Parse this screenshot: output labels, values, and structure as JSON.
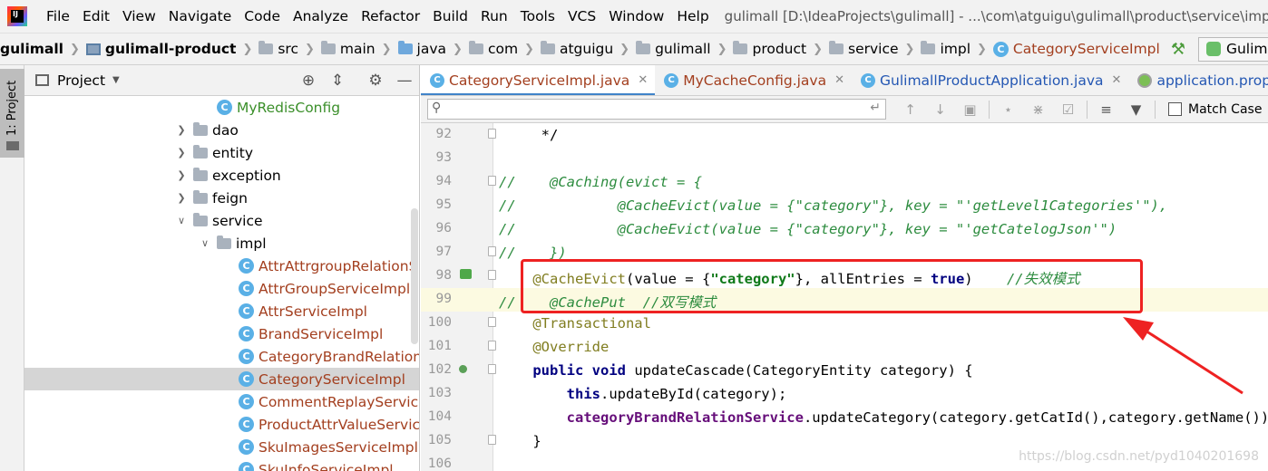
{
  "menubar": {
    "items": [
      "File",
      "Edit",
      "View",
      "Navigate",
      "Code",
      "Analyze",
      "Refactor",
      "Build",
      "Run",
      "Tools",
      "VCS",
      "Window",
      "Help"
    ],
    "title": "gulimall [D:\\IdeaProjects\\gulimall] - ...\\com\\atguigu\\gulimall\\product\\service\\impl\\C"
  },
  "breadcrumb": {
    "items": [
      "gulimall",
      "gulimall-product",
      "src",
      "main",
      "java",
      "com",
      "atguigu",
      "gulimall",
      "product",
      "service",
      "impl",
      "CategoryServiceImpl"
    ],
    "run_config": "GulimallProductApplicat"
  },
  "left_stripe": {
    "project_tab": "1: Project"
  },
  "project_panel": {
    "title": "Project",
    "tree": [
      {
        "label": "MyRedisConfig",
        "kind": "class-green",
        "indent": 2
      },
      {
        "label": "dao",
        "kind": "folder",
        "indent": 1
      },
      {
        "label": "entity",
        "kind": "folder",
        "indent": 1
      },
      {
        "label": "exception",
        "kind": "folder",
        "indent": 1
      },
      {
        "label": "feign",
        "kind": "folder",
        "indent": 1
      },
      {
        "label": "service",
        "kind": "folder-open",
        "indent": 1
      },
      {
        "label": "impl",
        "kind": "folder-open",
        "indent": 2
      },
      {
        "label": "AttrAttrgroupRelationS",
        "kind": "class",
        "indent": 3
      },
      {
        "label": "AttrGroupServiceImpl",
        "kind": "class",
        "indent": 3
      },
      {
        "label": "AttrServiceImpl",
        "kind": "class",
        "indent": 3
      },
      {
        "label": "BrandServiceImpl",
        "kind": "class",
        "indent": 3
      },
      {
        "label": "CategoryBrandRelationS",
        "kind": "class",
        "indent": 3
      },
      {
        "label": "CategoryServiceImpl",
        "kind": "class",
        "indent": 3,
        "selected": true
      },
      {
        "label": "CommentReplayService",
        "kind": "class",
        "indent": 3
      },
      {
        "label": "ProductAttrValueServic",
        "kind": "class",
        "indent": 3
      },
      {
        "label": "SkuImagesServiceImpl",
        "kind": "class",
        "indent": 3
      },
      {
        "label": "SkuInfoServiceImpl",
        "kind": "class",
        "indent": 3
      }
    ]
  },
  "editor_tabs": [
    {
      "label": "CategoryServiceImpl.java",
      "active": true
    },
    {
      "label": "MyCacheConfig.java",
      "active": false
    },
    {
      "label": "GulimallProductApplication.java",
      "active": false
    },
    {
      "label": "application.properties",
      "active": false
    }
  ],
  "search": {
    "placeholder": "",
    "match_case_label": "Match Case"
  },
  "code_lines": [
    {
      "n": "92",
      "html": "     */"
    },
    {
      "n": "93",
      "html": ""
    },
    {
      "n": "94",
      "html": "<span class='cmt'>//    @Caching(evict = {</span>"
    },
    {
      "n": "95",
      "html": "<span class='cmt'>//            @CacheEvict(value = {\"category\"}, key = \"'getLevel1Categories'\"),</span>"
    },
    {
      "n": "96",
      "html": "<span class='cmt'>//            @CacheEvict(value = {\"category\"}, key = \"'getCatelogJson'\")</span>"
    },
    {
      "n": "97",
      "html": "<span class='cmt'>//    })</span>"
    },
    {
      "n": "98",
      "html": "    <span class='ann'>@CacheEvict</span>(value = {<span class='str'>\"category\"</span>}, allEntries = <span class='kw'>true</span>)    <span class='cmt'>//失效模式</span>"
    },
    {
      "n": "99",
      "html": "<span class='cmt'>//    @CachePut  //双写模式</span>"
    },
    {
      "n": "100",
      "html": "    <span class='ann'>@Transactional</span>"
    },
    {
      "n": "101",
      "html": "    <span class='ann'>@Override</span>"
    },
    {
      "n": "102",
      "html": "    <span class='kw'>public void</span> updateCascade(CategoryEntity category) {"
    },
    {
      "n": "103",
      "html": "        <span class='kw'>this</span>.updateById(category);"
    },
    {
      "n": "104",
      "html": "        <span class='fld'>categoryBrandRelationService</span>.updateCategory(category.getCatId(),category.getName());"
    },
    {
      "n": "105",
      "html": "    }"
    },
    {
      "n": "106",
      "html": ""
    }
  ],
  "watermark": "https://blog.csdn.net/pyd1040201698",
  "colors": {
    "highlight": "#ee2222",
    "comment": "#2d8c3f",
    "annotation": "#807d20",
    "keyword": "#000080",
    "class_link": "#a33f1f"
  }
}
